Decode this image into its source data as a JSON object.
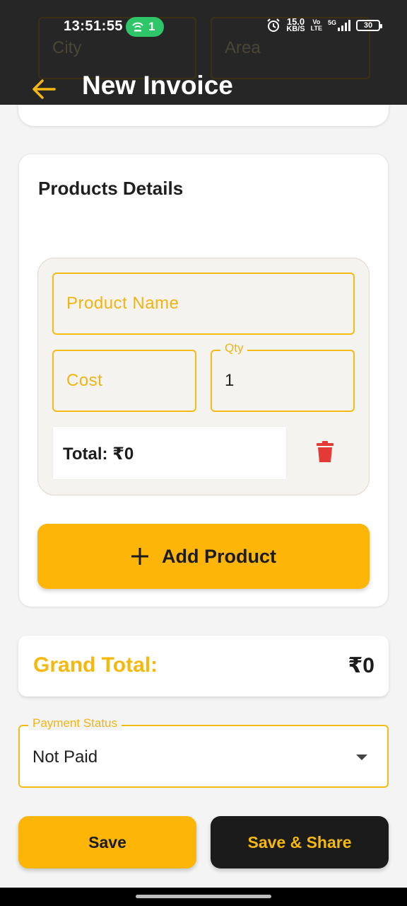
{
  "status_bar": {
    "time": "13:51:55",
    "hotspot_count": "1",
    "speed_value": "15.0",
    "speed_unit": "KB/S",
    "volte_top": "Vo",
    "volte_bottom": "LTE",
    "network": "5G",
    "battery": "30"
  },
  "background_form": {
    "city_placeholder": "City",
    "area_placeholder": "Area"
  },
  "header": {
    "title": "New Invoice",
    "back_icon": "arrow-left-icon"
  },
  "products": {
    "section_title": "Products Details",
    "items": [
      {
        "name_placeholder": "Product Name",
        "cost_placeholder": "Cost",
        "qty_label": "Qty",
        "qty_value": "1",
        "total_text": "Total: ₹0"
      }
    ],
    "add_button_label": "Add Product"
  },
  "summary": {
    "grand_total_label": "Grand Total:",
    "grand_total_value": "₹0"
  },
  "payment": {
    "label": "Payment Status",
    "value": "Not Paid"
  },
  "actions": {
    "save_label": "Save",
    "save_share_label": "Save & Share"
  },
  "colors": {
    "accent": "#fdb507",
    "accent_text": "#f5b80f",
    "header_bg": "#262626",
    "delete_red": "#e53935"
  }
}
